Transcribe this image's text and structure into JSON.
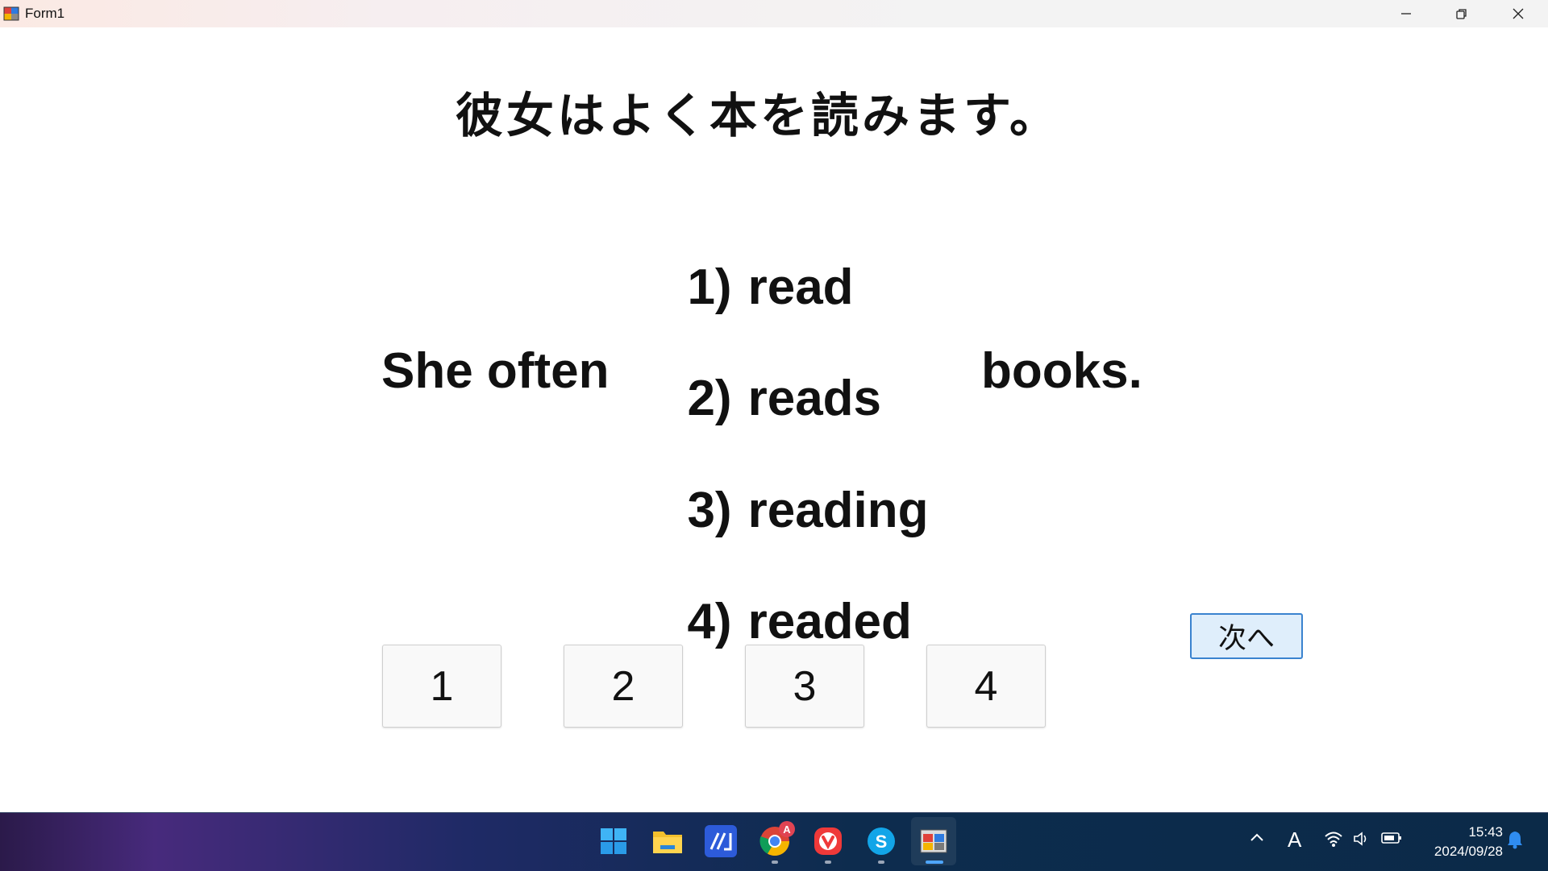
{
  "window": {
    "title": "Form1",
    "minimize_label": "minimize",
    "restore_label": "restore",
    "close_label": "close"
  },
  "quiz": {
    "question_ja": "彼女はよく本を読みます。",
    "sentence_left": "She often",
    "sentence_right": "books.",
    "options": [
      {
        "num": "1)",
        "text": "read"
      },
      {
        "num": "2)",
        "text": "reads"
      },
      {
        "num": "3)",
        "text": "reading"
      },
      {
        "num": "4)",
        "text": "readed"
      }
    ],
    "answer_buttons": [
      "1",
      "2",
      "3",
      "4"
    ],
    "next_button": "次へ"
  },
  "taskbar": {
    "pinned": [
      "start-icon",
      "file-explorer-icon",
      "dev-app-icon",
      "chrome-icon",
      "vivaldi-icon",
      "skype-icon",
      "form-app-icon"
    ],
    "chrome_badge": "A",
    "ime_indicator": "A",
    "time": "15:43",
    "date": "2024/09/28"
  },
  "colors": {
    "next_button_border": "#3a83cf",
    "next_button_bg": "#dfeefb",
    "taskbar_start": "#472a7c",
    "taskbar_end": "#0b2a48"
  }
}
